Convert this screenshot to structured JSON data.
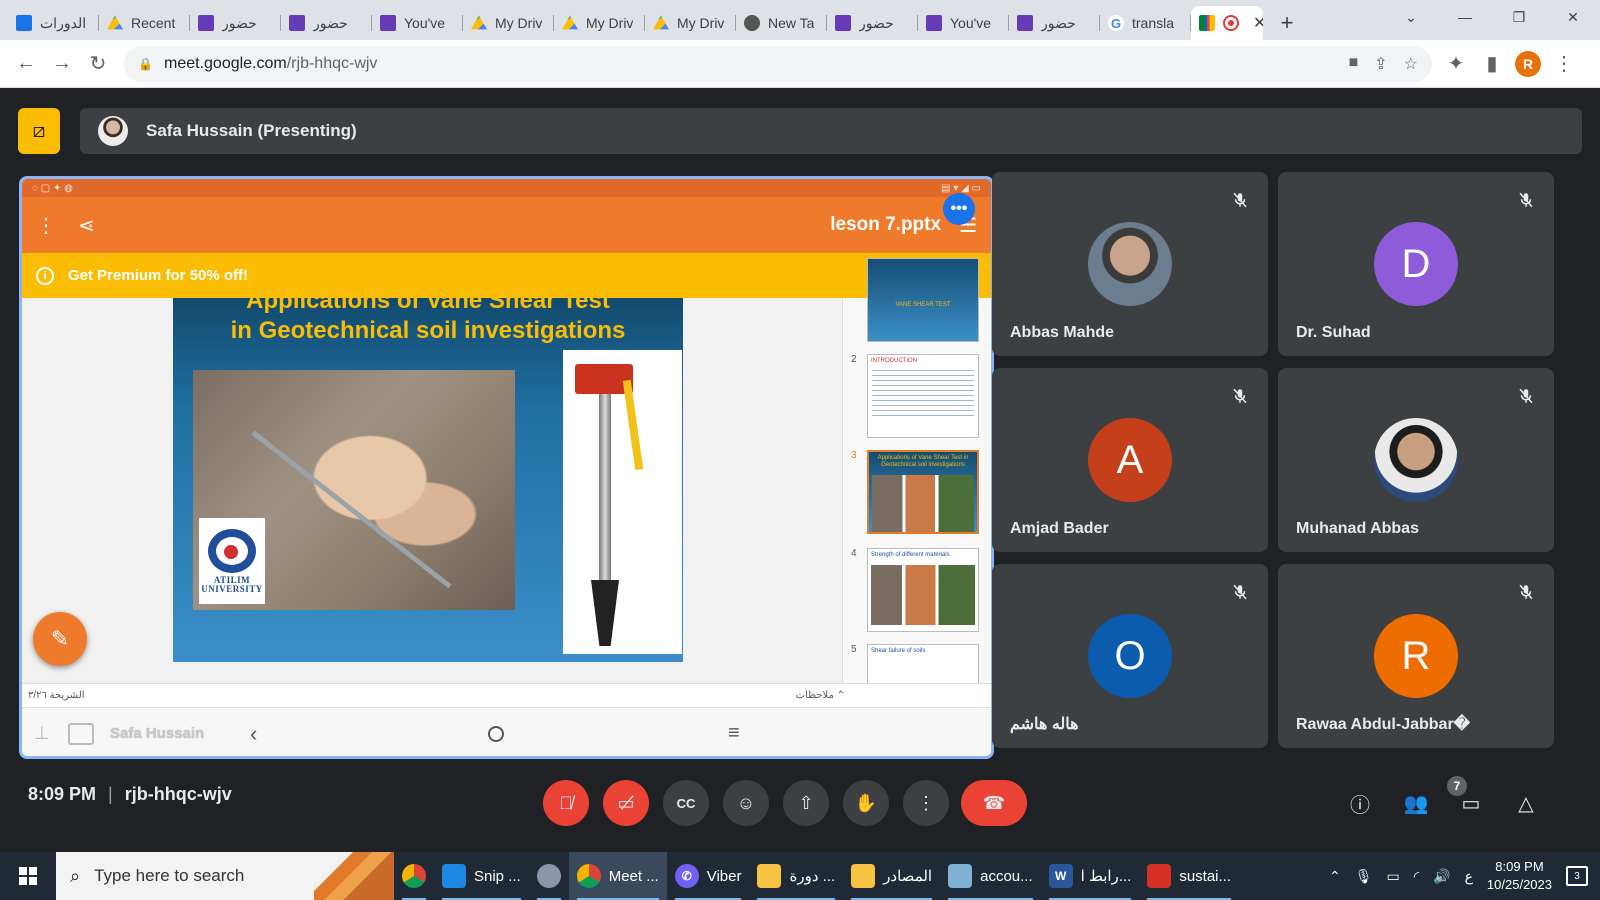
{
  "browser": {
    "tabs": [
      {
        "title": "الدورات",
        "icon": "classroom"
      },
      {
        "title": "Recent",
        "icon": "drive"
      },
      {
        "title": "حضور",
        "icon": "form"
      },
      {
        "title": "حضور",
        "icon": "form"
      },
      {
        "title": "You've",
        "icon": "form"
      },
      {
        "title": "My Driv",
        "icon": "drive"
      },
      {
        "title": "My Driv",
        "icon": "drive"
      },
      {
        "title": "My Driv",
        "icon": "drive"
      },
      {
        "title": "New Ta",
        "icon": "chrome"
      },
      {
        "title": "حضور",
        "icon": "form"
      },
      {
        "title": "You've",
        "icon": "form"
      },
      {
        "title": "حضور",
        "icon": "form"
      },
      {
        "title": "transla",
        "icon": "google"
      }
    ],
    "active_tab": {
      "icon": "meet",
      "recording": true
    },
    "url_host": "meet.google.com",
    "url_path": "/rjb-hhqc-wjv",
    "profile_initial": "R"
  },
  "meet": {
    "presenter_label": "Safa Hussain (Presenting)",
    "presentation": {
      "file_name": "leson 7.pptx",
      "promo_text": "Get Premium for 50% off!",
      "slide_title_line1": "Applications of Vane Shear Test",
      "slide_title_line2": "in Geotechnical soil investigations",
      "logo_text": "ATILIM UNIVERSITY",
      "slide_counter": "الشريحة ٣/٢٦",
      "notes_label": "ملاحظات",
      "watermark": "Safa Hussain",
      "thumbnails": [
        {
          "num": "",
          "title": "VANE SHEAR TEST"
        },
        {
          "num": "2",
          "title": "INTRODUCTION"
        },
        {
          "num": "3",
          "title": "Applications of Vane Shear Test in Geotechnical soil investigations"
        },
        {
          "num": "4",
          "title": "Strength of different materials"
        },
        {
          "num": "5",
          "title": "Shear failure of soils"
        }
      ]
    },
    "participants": [
      {
        "name": "Abbas Mahde",
        "initial": "",
        "color": ""
      },
      {
        "name": "Dr. Suhad",
        "initial": "D",
        "color": "#8e5cd9"
      },
      {
        "name": "Amjad Bader",
        "initial": "A",
        "color": "#c5401a"
      },
      {
        "name": "Muhanad Abbas",
        "initial": "",
        "color": ""
      },
      {
        "name": "هاله هاشم",
        "initial": "O",
        "color": "#0b5cad"
      },
      {
        "name": "Rawaa Abdul-Jabbar�",
        "initial": "R",
        "color": "#ef6c00"
      }
    ],
    "time": "8:09 PM",
    "meeting_code": "rjb-hhqc-wjv",
    "people_count": "7"
  },
  "taskbar": {
    "search_placeholder": "Type here to search",
    "items": [
      {
        "label": "",
        "icon": "chrome"
      },
      {
        "label": "Snip ...",
        "icon": "snip"
      },
      {
        "label": "",
        "icon": "bird"
      },
      {
        "label": "Meet ...",
        "icon": "chrome"
      },
      {
        "label": "Viber",
        "icon": "viber"
      },
      {
        "label": "دورة ...",
        "icon": "folder"
      },
      {
        "label": "المصادر",
        "icon": "folder"
      },
      {
        "label": "accou...",
        "icon": "acc"
      },
      {
        "label": "رابط ا...",
        "icon": "word"
      },
      {
        "label": "sustai...",
        "icon": "pdf"
      }
    ],
    "lang": "ع",
    "tray_time": "8:09 PM",
    "tray_date": "10/25/2023",
    "notif_count": "3"
  }
}
